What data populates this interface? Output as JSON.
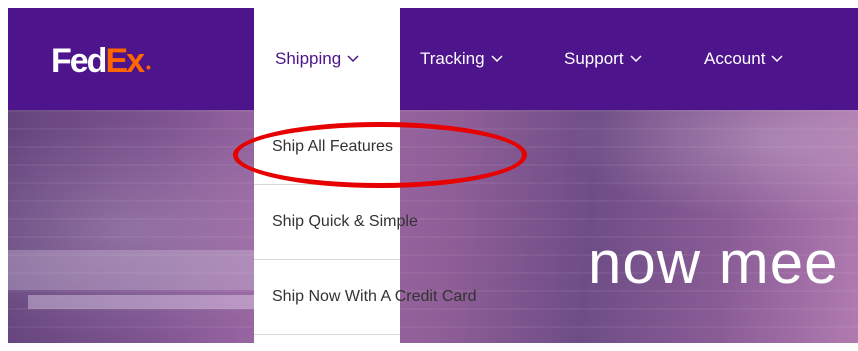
{
  "brand": {
    "logo_fed": "Fed",
    "logo_ex": "Ex",
    "logo_dot": "•",
    "primary_color": "#4d148c",
    "accent_color": "#ff6600"
  },
  "nav": {
    "items": [
      {
        "label": "Shipping",
        "icon": "chevron-down-icon",
        "active": true
      },
      {
        "label": "Tracking",
        "icon": "chevron-down-icon",
        "active": false
      },
      {
        "label": "Support",
        "icon": "chevron-down-icon",
        "active": false
      },
      {
        "label": "Account",
        "icon": "chevron-down-icon",
        "active": false
      }
    ]
  },
  "dropdown": {
    "items": [
      {
        "label": "Ship All Features"
      },
      {
        "label": "Ship Quick & Simple"
      },
      {
        "label": "Ship Now With A Credit Card"
      }
    ]
  },
  "annotation": {
    "color": "#e60000",
    "target": "Ship All Features"
  },
  "hero": {
    "headline": "now mee"
  }
}
